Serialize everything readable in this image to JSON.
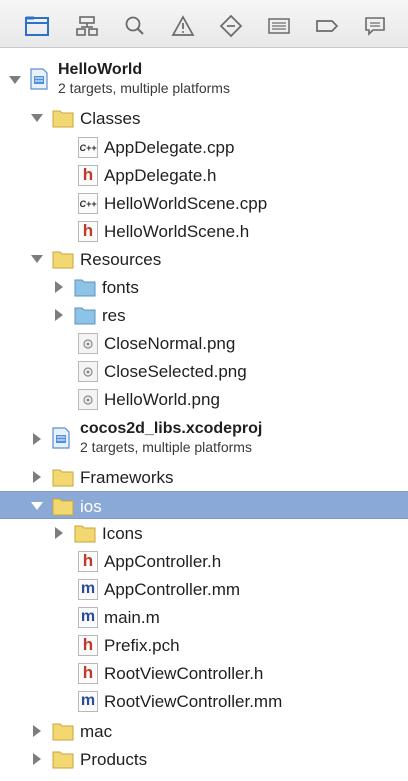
{
  "toolbar": {
    "icons": [
      "folder-icon",
      "hierarchy-icon",
      "search-icon",
      "warning-icon",
      "diamond-icon",
      "list-icon",
      "tag-icon",
      "chat-icon"
    ],
    "selected_color": "#2a71c9"
  },
  "tree": {
    "project": {
      "name": "HelloWorld",
      "subtitle": "2 targets, multiple platforms"
    },
    "classes": {
      "label": "Classes",
      "files": [
        {
          "name": "AppDelegate.cpp",
          "type": "cpp"
        },
        {
          "name": "AppDelegate.h",
          "type": "h"
        },
        {
          "name": "HelloWorldScene.cpp",
          "type": "cpp"
        },
        {
          "name": "HelloWorldScene.h",
          "type": "h"
        }
      ]
    },
    "resources": {
      "label": "Resources",
      "folders": [
        "fonts",
        "res"
      ],
      "files": [
        "CloseNormal.png",
        "CloseSelected.png",
        "HelloWorld.png"
      ]
    },
    "subproject": {
      "name": "cocos2d_libs.xcodeproj",
      "subtitle": "2 targets, multiple platforms"
    },
    "frameworks": {
      "label": "Frameworks"
    },
    "ios": {
      "label": "ios",
      "folder": "Icons",
      "files": [
        {
          "name": "AppController.h",
          "type": "h"
        },
        {
          "name": "AppController.mm",
          "type": "m"
        },
        {
          "name": "main.m",
          "type": "m"
        },
        {
          "name": "Prefix.pch",
          "type": "h"
        },
        {
          "name": "RootViewController.h",
          "type": "h"
        },
        {
          "name": "RootViewController.mm",
          "type": "m"
        }
      ]
    },
    "mac": {
      "label": "mac"
    },
    "products": {
      "label": "Products"
    }
  },
  "badges": {
    "h": "h",
    "m": "m",
    "cpp": "C++"
  },
  "colors": {
    "selection": "#8aa9d6",
    "folder": "#f3d871",
    "blue_folder": "#8ec3e8"
  }
}
